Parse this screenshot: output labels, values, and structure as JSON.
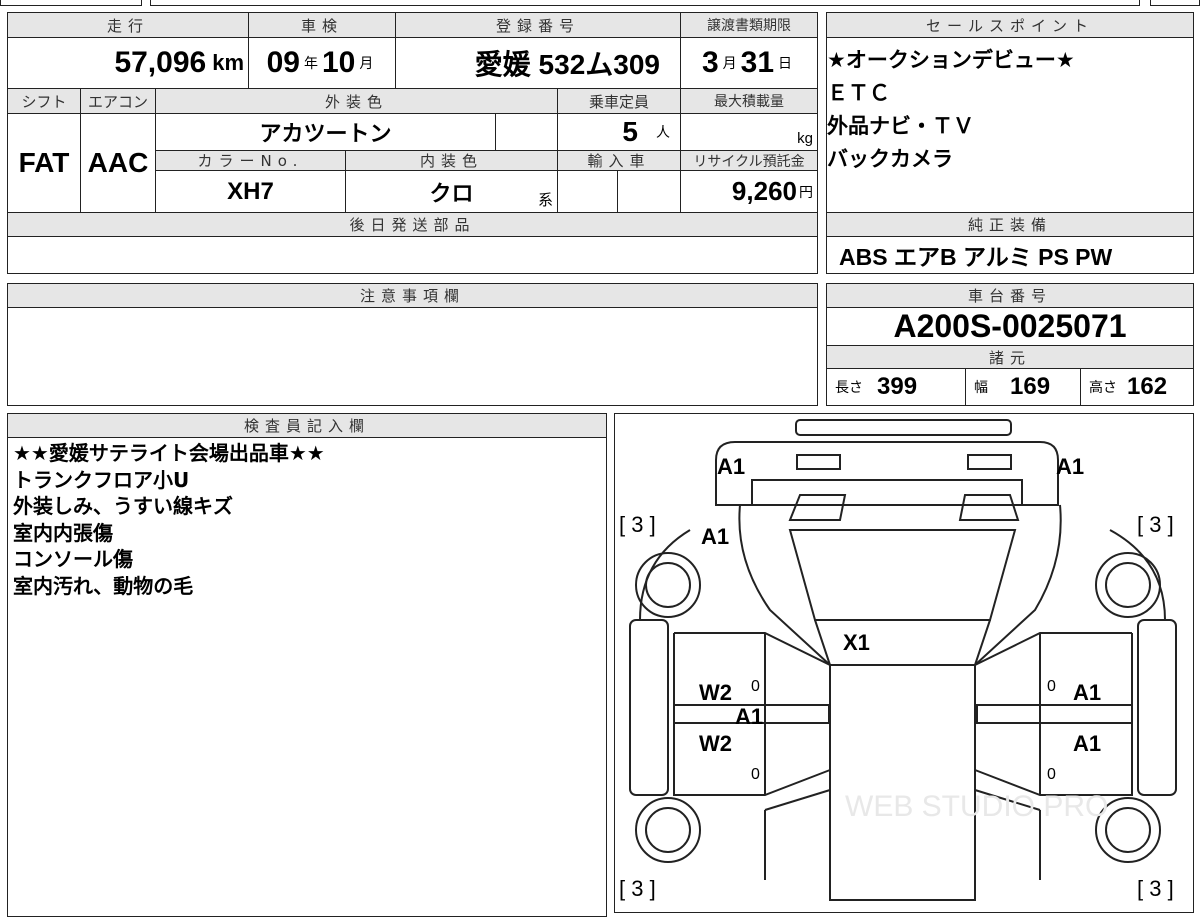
{
  "main": {
    "mileage_label": "走行",
    "mileage": "57,096",
    "mileage_unit": "km",
    "inspection_label": "車検",
    "inspection_year": "09",
    "year_unit": "年",
    "inspection_month": "10",
    "month_unit": "月",
    "reg_label": "登録番号",
    "reg_value": "愛媛 532ム309",
    "transfer_label": "譲渡書類期限",
    "transfer_month": "3",
    "transfer_day": "31",
    "day_unit": "日"
  },
  "spec": {
    "shift_label": "シフト",
    "shift": "FAT",
    "ac_label": "エアコン",
    "ac": "AAC",
    "ext_color_label": "外装色",
    "ext_color": "アカツートン",
    "capacity_label": "乗車定員",
    "capacity": "5",
    "capacity_unit": "人",
    "load_label": "最大積載量",
    "load_unit": "kg",
    "color_no_label": "カラーNo.",
    "color_no": "XH7",
    "int_color_label": "内装色",
    "int_color": "クロ",
    "int_color_suffix": "系",
    "import_label": "輸入車",
    "recycle_label": "リサイクル預託金",
    "recycle": "9,260",
    "recycle_unit": "円"
  },
  "parts": {
    "label": "後日発送部品"
  },
  "notes": {
    "label": "注意事項欄"
  },
  "sales": {
    "label": "セールスポイント",
    "items": [
      "★オークションデビュー★",
      "ＥＴＣ",
      "外品ナビ・ＴＶ",
      "バックカメラ"
    ]
  },
  "equipment": {
    "label": "純正装備",
    "value": "ABS エアB アルミ PS PW"
  },
  "chassis": {
    "label": "車台番号",
    "value": "A200S-0025071"
  },
  "dimensions": {
    "label": "諸元",
    "length_label": "長さ",
    "length": "399",
    "width_label": "幅",
    "width": "169",
    "height_label": "高さ",
    "height": "162"
  },
  "inspector": {
    "label": "検査員記入欄",
    "lines": [
      "★★愛媛サテライト会場出品車★★",
      "トランクフロア小U",
      "外装しみ、うすい線キズ",
      "室内内張傷",
      "コンソール傷",
      "室内汚れ、動物の毛"
    ]
  },
  "diagram": {
    "marks": {
      "front_left": "A1",
      "front_right": "A1",
      "bracket_tl": "[ 3 ]",
      "bracket_tr": "[ 3 ]",
      "bracket_bl": "[ 3 ]",
      "bracket_br": "[ 3 ]",
      "hood_left": "A1",
      "roof": "X1",
      "left_front_door": "W2",
      "left_rear_door": "W2",
      "left_pillar": "A1",
      "right_front_door": "A1",
      "right_rear_door": "A1",
      "zero1": "0",
      "zero2": "0",
      "zero3": "0",
      "zero4": "0"
    },
    "watermark": "WEB STUDIO PRO"
  }
}
